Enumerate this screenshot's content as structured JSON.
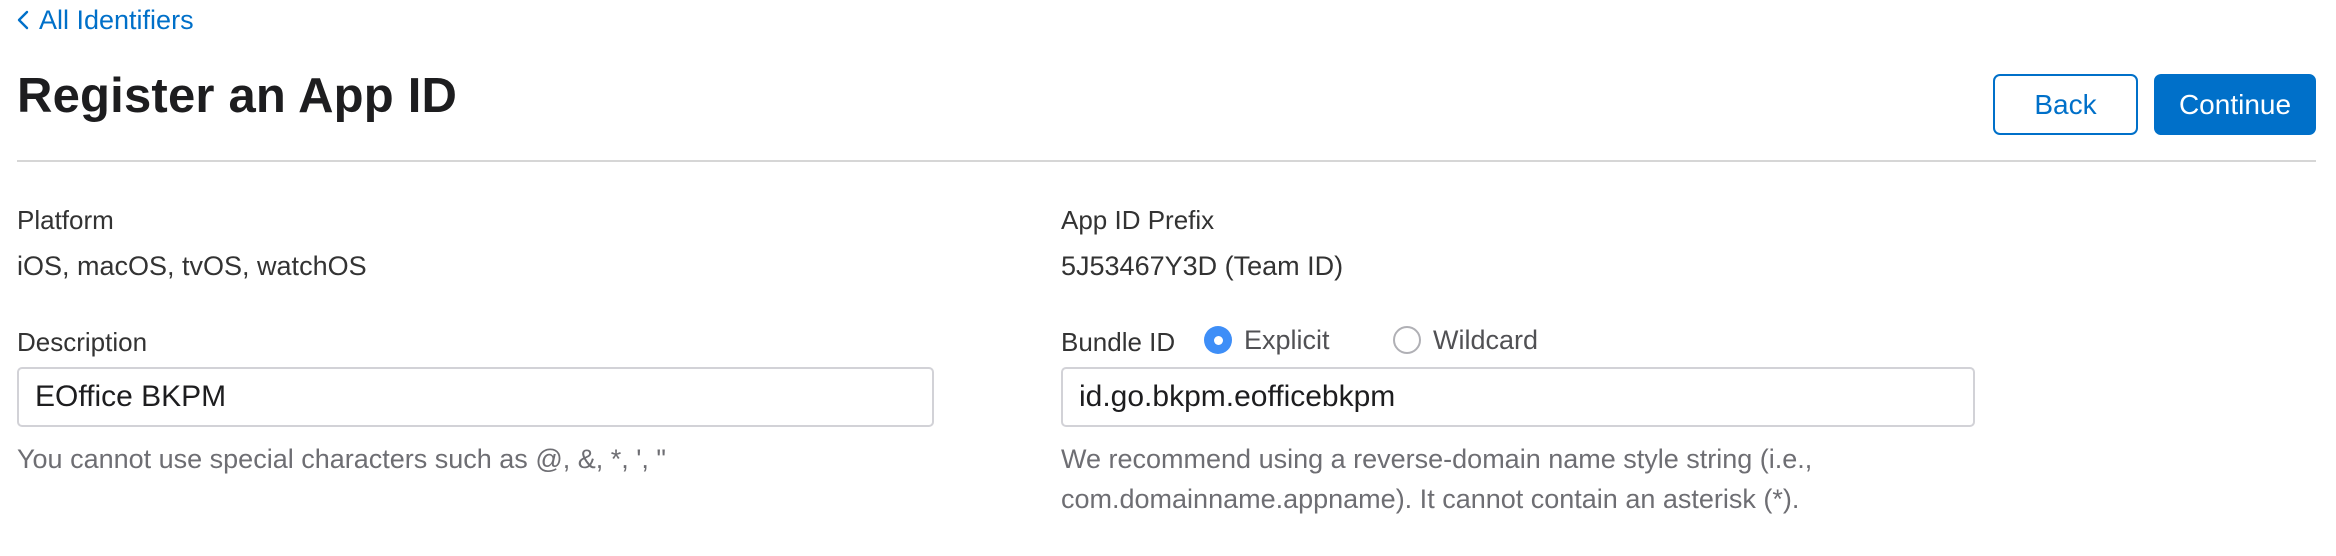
{
  "nav": {
    "back_link_label": "All Identifiers"
  },
  "header": {
    "title": "Register an App ID",
    "back_button": "Back",
    "continue_button": "Continue"
  },
  "platform": {
    "label": "Platform",
    "value": "iOS, macOS, tvOS, watchOS"
  },
  "prefix": {
    "label": "App ID Prefix",
    "value": "5J53467Y3D (Team ID)"
  },
  "description": {
    "label": "Description",
    "value": "EOffice BKPM",
    "hint": "You cannot use special characters such as @, &, *, ', \""
  },
  "bundle": {
    "label": "Bundle ID",
    "options": [
      {
        "label": "Explicit",
        "selected": true
      },
      {
        "label": "Wildcard",
        "selected": false
      }
    ],
    "value": "id.go.bkpm.eofficebkpm",
    "hint_line1": "We recommend using a reverse-domain name style string (i.e.,",
    "hint_line2": "com.domainname.appname). It cannot contain an asterisk (*)."
  },
  "colors": {
    "accent": "#0070c9",
    "radio_selected": "#3e8ef7",
    "divider": "#d6d6d6",
    "hint_text": "#6e6e73"
  }
}
